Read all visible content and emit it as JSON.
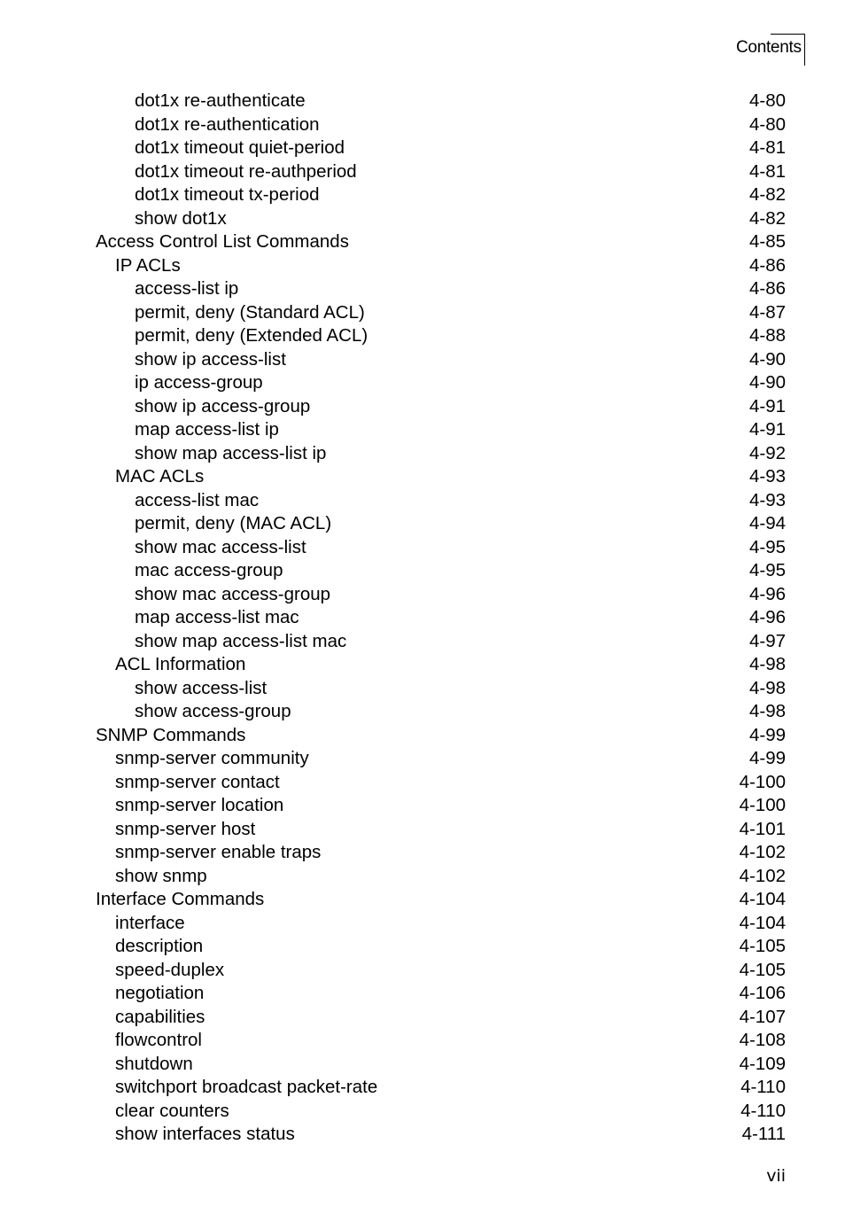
{
  "header": {
    "section_label": "Contents"
  },
  "toc": [
    {
      "level": 3,
      "title": "dot1x re-authenticate",
      "page": "4-80"
    },
    {
      "level": 3,
      "title": "dot1x re-authentication",
      "page": "4-80"
    },
    {
      "level": 3,
      "title": "dot1x timeout quiet-period",
      "page": "4-81"
    },
    {
      "level": 3,
      "title": "dot1x timeout re-authperiod",
      "page": "4-81"
    },
    {
      "level": 3,
      "title": "dot1x timeout tx-period",
      "page": "4-82"
    },
    {
      "level": 3,
      "title": "show dot1x",
      "page": "4-82"
    },
    {
      "level": 1,
      "title": "Access Control List Commands",
      "page": "4-85"
    },
    {
      "level": 2,
      "title": "IP ACLs",
      "page": "4-86"
    },
    {
      "level": 3,
      "title": "access-list ip",
      "page": "4-86"
    },
    {
      "level": 3,
      "title": "permit, deny (Standard ACL)",
      "page": "4-87"
    },
    {
      "level": 3,
      "title": "permit, deny (Extended ACL)",
      "page": "4-88"
    },
    {
      "level": 3,
      "title": "show ip access-list",
      "page": "4-90"
    },
    {
      "level": 3,
      "title": "ip access-group",
      "page": "4-90"
    },
    {
      "level": 3,
      "title": "show ip access-group",
      "page": "4-91"
    },
    {
      "level": 3,
      "title": "map access-list ip",
      "page": "4-91"
    },
    {
      "level": 3,
      "title": "show map access-list ip",
      "page": "4-92"
    },
    {
      "level": 2,
      "title": "MAC ACLs",
      "page": "4-93"
    },
    {
      "level": 3,
      "title": "access-list mac",
      "page": "4-93"
    },
    {
      "level": 3,
      "title": "permit, deny (MAC ACL)",
      "page": "4-94"
    },
    {
      "level": 3,
      "title": "show mac access-list",
      "page": "4-95"
    },
    {
      "level": 3,
      "title": "mac access-group",
      "page": "4-95"
    },
    {
      "level": 3,
      "title": "show mac access-group",
      "page": "4-96"
    },
    {
      "level": 3,
      "title": "map access-list mac",
      "page": "4-96"
    },
    {
      "level": 3,
      "title": "show map access-list mac",
      "page": "4-97"
    },
    {
      "level": 2,
      "title": "ACL Information",
      "page": "4-98"
    },
    {
      "level": 3,
      "title": "show access-list",
      "page": "4-98"
    },
    {
      "level": 3,
      "title": "show access-group",
      "page": "4-98"
    },
    {
      "level": 1,
      "title": "SNMP Commands",
      "page": "4-99"
    },
    {
      "level": 2,
      "title": "snmp-server community",
      "page": "4-99"
    },
    {
      "level": 2,
      "title": "snmp-server contact",
      "page": "4-100"
    },
    {
      "level": 2,
      "title": "snmp-server location",
      "page": "4-100"
    },
    {
      "level": 2,
      "title": "snmp-server host",
      "page": "4-101"
    },
    {
      "level": 2,
      "title": "snmp-server enable traps",
      "page": "4-102"
    },
    {
      "level": 2,
      "title": "show snmp",
      "page": "4-102"
    },
    {
      "level": 1,
      "title": "Interface Commands",
      "page": "4-104"
    },
    {
      "level": 2,
      "title": "interface",
      "page": "4-104"
    },
    {
      "level": 2,
      "title": "description",
      "page": "4-105"
    },
    {
      "level": 2,
      "title": "speed-duplex",
      "page": "4-105"
    },
    {
      "level": 2,
      "title": "negotiation",
      "page": "4-106"
    },
    {
      "level": 2,
      "title": "capabilities",
      "page": "4-107"
    },
    {
      "level": 2,
      "title": "flowcontrol",
      "page": "4-108"
    },
    {
      "level": 2,
      "title": "shutdown",
      "page": "4-109"
    },
    {
      "level": 2,
      "title": "switchport broadcast packet-rate",
      "page": "4-110"
    },
    {
      "level": 2,
      "title": "clear counters",
      "page": "4-110"
    },
    {
      "level": 2,
      "title": "show interfaces status",
      "page": "4-111"
    }
  ],
  "footer": {
    "page_number": "vii"
  }
}
